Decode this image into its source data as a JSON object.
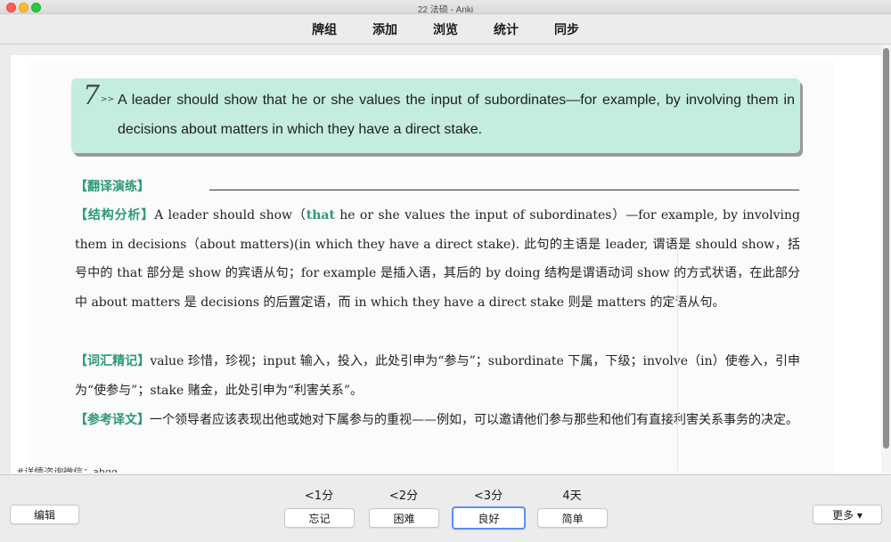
{
  "window": {
    "title": "22 法硕 - Anki"
  },
  "toolbar": {
    "items": [
      "牌组",
      "添加",
      "浏览",
      "统计",
      "同步"
    ]
  },
  "card": {
    "number": "7",
    "number_arrows": ">>",
    "question": "A leader should show that he or she values the input of subordinates—for example, by involving them in decisions about matters in which they have a direct stake.",
    "translate_tag": "【翻译演练】",
    "structure_tag": "【结构分析】",
    "structure_lead": "A leader should show（",
    "structure_that": "that",
    "structure_rest": " he or she values the input of subordinates）—for example, by involving them in decisions（about matters)(in which they have a direct stake). 此句的主语是 leader, 谓语是 should show，括号中的 that 部分是 show 的宾语从句；for example 是插入语，其后的 by doing 结构是谓语动词 show 的方式状语，在此部分中 about matters 是 decisions 的后置定语，而 in which they have a direct stake 则是 matters 的定语从句。",
    "vocab_tag": "【词汇精记】",
    "vocab_text": "value 珍惜，珍视；input 输入，投入，此处引申为“参与”；subordinate 下属，下级；involve（in）使卷入，引申为“使参与”；stake 赌金，此处引申为“利害关系”。",
    "ref_tag": "【参考译文】",
    "ref_text": "一个领导者应该表现出他或她对下属参与的重视——例如，可以邀请他们参与那些和他们有直接利害关系事务的决定。",
    "footer_tag": "#详情咨询微信：ahqq"
  },
  "bottom": {
    "edit_label": "编辑",
    "more_label": "更多 ▾",
    "answers": [
      {
        "interval": "<1分",
        "label": "忘记"
      },
      {
        "interval": "<2分",
        "label": "困难"
      },
      {
        "interval": "<3分",
        "label": "良好"
      },
      {
        "interval": "4天",
        "label": "简单"
      }
    ]
  },
  "colors": {
    "highlight_box": "#c5ece0",
    "tag_green": "#2b9a78",
    "default_button_border": "#5b8ff0"
  }
}
